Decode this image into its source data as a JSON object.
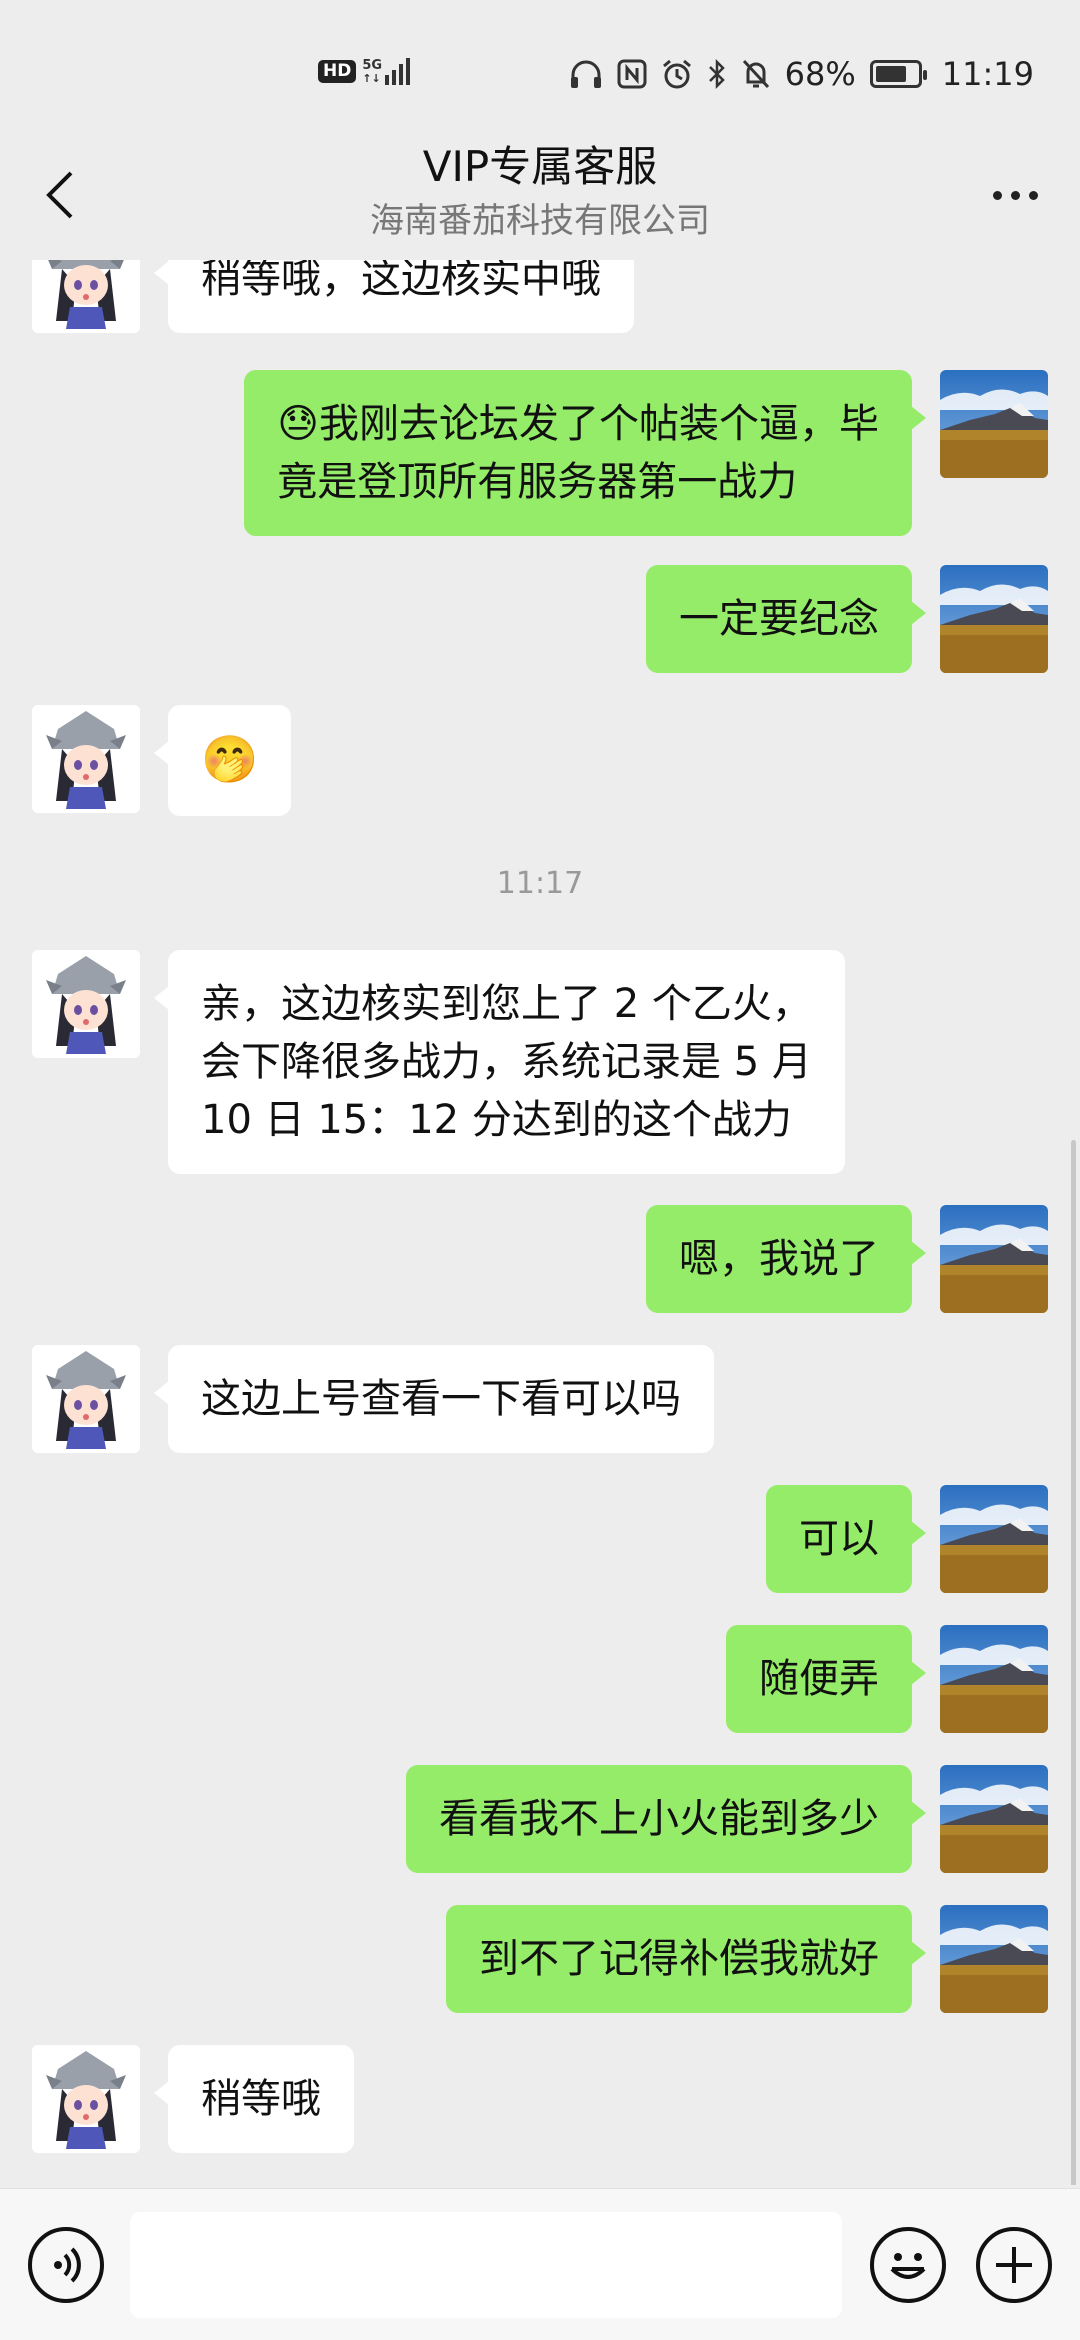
{
  "status_bar": {
    "hd": "HD",
    "network": "5G",
    "battery_percent": "68%",
    "battery_level": 0.68,
    "time": "11:19",
    "icons": [
      "headphones-icon",
      "nfc-icon",
      "alarm-icon",
      "bluetooth-icon",
      "mute-bell-icon",
      "battery-icon"
    ]
  },
  "header": {
    "title": "VIP专属客服",
    "subtitle": "海南番茄科技有限公司",
    "back_icon": "chevron-left-icon",
    "more_icon": "more-dots-icon"
  },
  "colors": {
    "outgoing_bubble": "#95ec69",
    "incoming_bubble": "#ffffff",
    "background": "#ededed"
  },
  "messages": [
    {
      "side": "left",
      "lines": [
        "稍等哦，这边核实中哦"
      ]
    },
    {
      "side": "right",
      "emoji": "😓",
      "lines": [
        "我刚去论坛发了个帖装个逼，毕",
        "竟是登顶所有服务器第一战力"
      ]
    },
    {
      "side": "right",
      "lines": [
        "一定要纪念"
      ]
    },
    {
      "side": "left",
      "emoji": "🤭",
      "lines": []
    },
    {
      "side": "left",
      "lines": [
        "亲，这边核实到您上了 2 个乙火，",
        "会下降很多战力，系统记录是 5 月",
        "10 日 15：12 分达到的这个战力"
      ]
    },
    {
      "side": "right",
      "lines": [
        "嗯，我说了"
      ]
    },
    {
      "side": "left",
      "lines": [
        "这边上号查看一下看可以吗"
      ]
    },
    {
      "side": "right",
      "lines": [
        "可以"
      ]
    },
    {
      "side": "right",
      "lines": [
        "随便弄"
      ]
    },
    {
      "side": "right",
      "lines": [
        "看看我不上小火能到多少"
      ]
    },
    {
      "side": "right",
      "lines": [
        "到不了记得补偿我就好"
      ]
    },
    {
      "side": "left",
      "lines": [
        "稍等哦"
      ]
    }
  ],
  "timestamp": "11:17",
  "input_bar": {
    "voice_icon": "voice-icon",
    "emoji_icon": "emoji-icon",
    "plus_icon": "plus-icon",
    "input_value": ""
  }
}
